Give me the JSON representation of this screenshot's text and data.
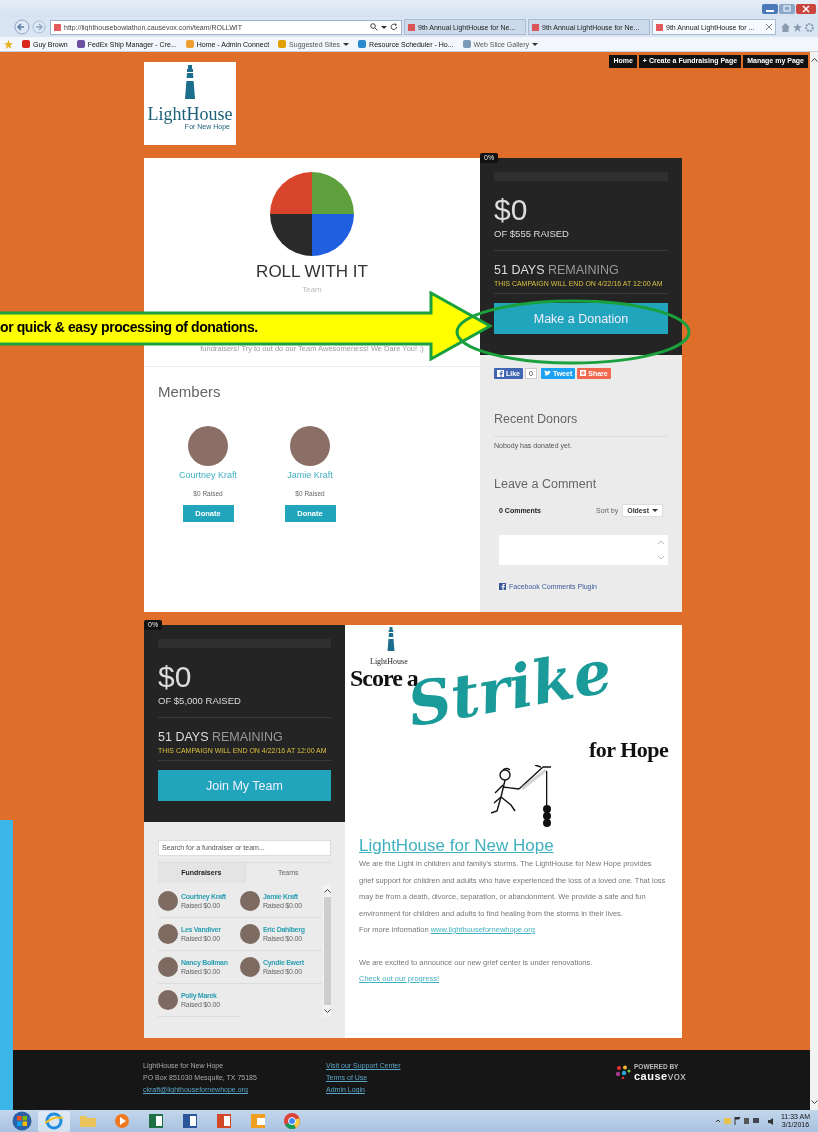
{
  "browser": {
    "address": "http://lighthousebowlathon.causevox.com/team/ROLLWIT",
    "tabs": [
      {
        "label": "9th Annual LightHouse for Ne...",
        "selected": false
      },
      {
        "label": "9th Annual LightHouse for Ne...",
        "selected": false
      },
      {
        "label": "9th Annual LightHouse for ...",
        "selected": true
      }
    ],
    "favorites": [
      {
        "label": "Guy Brown",
        "dropdown": false
      },
      {
        "label": "FedEx Ship Manager - Cre...",
        "dropdown": false
      },
      {
        "label": "Home - Admin Connect",
        "dropdown": false
      },
      {
        "label": "Suggested Sites",
        "dropdown": true
      },
      {
        "label": "Resource Scheduler - Ho...",
        "dropdown": false
      },
      {
        "label": "Web Slice Gallery",
        "dropdown": true
      }
    ]
  },
  "nav": [
    "Home",
    "+ Create a Fundraising Page",
    "Manage my Page"
  ],
  "logo": {
    "name": "LightHouse",
    "tagline": "For New Hope"
  },
  "team": {
    "title": "ROLL WITH IT",
    "subtitle": "Team",
    "description": "fundraisers!  Try to out do our Team Awesomeness!  We Dare You! :)",
    "members_heading": "Members",
    "members": [
      {
        "name": "Courtney Kraft",
        "raised": "$0 Raised",
        "button": "Donate"
      },
      {
        "name": "Jamie Kraft",
        "raised": "$0 Raised",
        "button": "Donate"
      }
    ]
  },
  "campaign": {
    "percent": "0%",
    "level": 0,
    "amount": "$0",
    "goal": "OF $555 RAISED",
    "days": "51 DAYS",
    "remaining": "REMAINING",
    "end_note": "THIS CAMPAIGN WILL END ON 4/22/16 AT 12:00 AM",
    "button": "Make a Donation"
  },
  "social": {
    "like": "Like",
    "like_count": "0",
    "tweet": "Tweet",
    "share": "Share"
  },
  "recent_donors": {
    "heading": "Recent Donors",
    "empty": "Nobody has donated yet."
  },
  "comments": {
    "heading": "Leave a Comment",
    "count": "0 Comments",
    "sort_label": "Sort by",
    "sort_value": "Oldest",
    "plugin": "Facebook Comments Plugin"
  },
  "team_campaign": {
    "percent": "0%",
    "level": 0,
    "amount": "$0",
    "goal": "OF $5,000 RAISED",
    "days": "51 DAYS",
    "remaining": "REMAINING",
    "end_note": "THIS CAMPAIGN WILL END ON 4/22/16 AT 12:00 AM",
    "button": "Join My Team"
  },
  "search": {
    "placeholder": "Search for a fundraiser or team..."
  },
  "list_tabs": [
    {
      "label": "Fundraisers",
      "selected": true
    },
    {
      "label": "Teams",
      "selected": false
    }
  ],
  "fundraisers": [
    {
      "name": "Courtney Kraft",
      "raised": "Raised $0.00"
    },
    {
      "name": "Jamie Kraft",
      "raised": "Raised $0.00"
    },
    {
      "name": "Les Vandiver",
      "raised": "Raised $0.00"
    },
    {
      "name": "Eric Dahlberg",
      "raised": "Raised $0.00"
    },
    {
      "name": "Nancy Bollman",
      "raised": "Raised $0.00"
    },
    {
      "name": "Cyndie Ewert",
      "raised": "Raised $0.00"
    },
    {
      "name": "Polly Marek",
      "raised": "Raised $0.00"
    }
  ],
  "banner": {
    "org": "LightHouse",
    "top": "Score a",
    "script": "Strike",
    "bottom": "for Hope"
  },
  "about": {
    "title": "LightHouse for New Hope",
    "paragraph": "We are the Light in children and family's storms.  The LightHouse for New Hope provides grief support for children and adults who have experienced the loss of a loved one.  That loss may be from a death, divorce, separation, or abandonment. We provide a safe and fun environment for children and adults to find healing from the storms in their lives.",
    "more_label": "For more information",
    "more_link": "www.lighthousefornewhope.org",
    "news": "We are excited to announce our new grief center is under renovations.",
    "news_link": "Check out our progress!"
  },
  "footer": {
    "lines": [
      "LightHouse for New Hope",
      "PO Box 851030 Mesquite, TX 75185"
    ],
    "email": "ckraft@lighthousefornewhope.org",
    "links": [
      "Visit our Support Center",
      "Terms of Use",
      "Admin Login"
    ],
    "powered_by": "POWERED BY",
    "brand": "**cause**vox"
  },
  "annotation": {
    "text": "or quick & easy processing of donations."
  },
  "taskbar": {
    "time": "11:33 AM",
    "date": "3/1/2016"
  }
}
